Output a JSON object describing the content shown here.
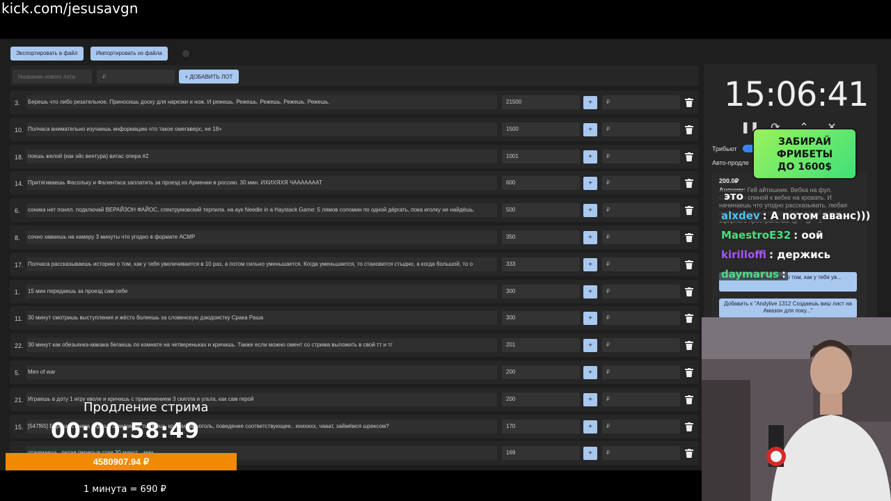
{
  "channel_url": "kick.com/jesusavgn",
  "toolbar": {
    "export_label": "Экспортировать в файл",
    "import_label": "Импортировать из файла"
  },
  "add_lot": {
    "name_placeholder": "Название нового лота",
    "amount_placeholder": "₽",
    "button_label": "+ ДОБАВИТЬ ЛОТ"
  },
  "lots": [
    {
      "num": "3.",
      "desc": "Берешь что либо резательное. Приносишь доску для нарезки и нож. И режешь. Режешь. Режешь. Режешь. Режешь.",
      "amount": "21500"
    },
    {
      "num": "10.",
      "desc": "Полчаса внимательно изучаешь информацию что такое омегаверс, не 18+",
      "amount": "1500"
    },
    {
      "num": "18.",
      "desc": "поешь желой (как эйс вентура) витас опера #2",
      "amount": "1001"
    },
    {
      "num": "14.",
      "desc": "Притягиваешь Фасольку и Фалентаса заплатить за проезд из Армении в россию. 30 мин. ИХИХЯХЯ ЧАААААААТ",
      "amount": "600"
    },
    {
      "num": "6.",
      "desc": "соника нет понял. подключай ВЕРАЙЗОН ФАЙОС, спектрумовский терпила. на аук Needle in a Haystack Game: 5 лямов соломин по одной дёргать, пока иголку не найдёшь.",
      "amount": "500"
    },
    {
      "num": "8.",
      "desc": "сочно хаваешь на камеру 3 минуты что угодно в формате АСМР",
      "amount": "350"
    },
    {
      "num": "17.",
      "desc": "Полчаса рассказываешь историю о том, как у тебя увеличивается в 10 раз, а потом сильно уменьшается. Когда уменьшается, то становится стыдно, а когда большой, то о",
      "amount": "333"
    },
    {
      "num": "1.",
      "desc": "15 мин передаешь за проезд сам себе",
      "amount": "300"
    },
    {
      "num": "11.",
      "desc": "30 минут смотришь выступления и жёсто болеешь за словенскую дзюдоистку Срака Раша",
      "amount": "300"
    },
    {
      "num": "22.",
      "desc": "30 минут как обезьянка-макака бегаешь по комнате на четвереньках и кричишь. Также если можно омент со стрима выложить в свой тт и тг",
      "amount": "201"
    },
    {
      "num": "5.",
      "desc": "Men of war",
      "amount": "200"
    },
    {
      "num": "21.",
      "desc": "Играешь в доту 1 игру кволе и кричишь с применением 3 скилла и ульта, как сам герой",
      "amount": "200"
    },
    {
      "num": "15.",
      "desc": "[547f65] Берешь стрима сидишь с видом ну ты пьешь крепкий алкоголь, поведение соответствующее.. ихихихх, чааат, займёмся шрексом?",
      "amount": "170"
    },
    {
      "num": "",
      "desc": "отжимаешь, делая перерыв стая 30 минут... мин",
      "amount": "169"
    }
  ],
  "rub_placeholder": "₽",
  "plus_label": "+",
  "timer": {
    "clock": "15:06:41",
    "tributes_label": "Трибьют",
    "autoextend_label": "Авто-продле"
  },
  "promo": {
    "line1": "ЗАБИРАЙ",
    "line2": "ФРИБЕТЫ",
    "line3": "ДО 1600$"
  },
  "donation": {
    "amount": "200.0₽",
    "author": "Аноним:",
    "text": "Гей айтишник. Вебка на фул. Садишся спиной к вебке на кровать. И начинаешь что угодно рассказывать. любая история, словно говори без сделай вокруг эфирного пространства. @ ~ @ ~ z",
    "suggest1": "...вадаешь историю о том, как у тебя ув...",
    "suggest2": "Добавить к \"Andylive 1312 Создаешь виш лист на Амазон для поку...\""
  },
  "chat": [
    {
      "user": "",
      "msg": "это",
      "color": "#ffffff"
    },
    {
      "user": "alxdev",
      "msg": ": А потом аванс)))",
      "color": "#4fc3f7"
    },
    {
      "user": "MaestroE32",
      "msg": ": оой",
      "color": "#4ade80"
    },
    {
      "user": "kirilloffi",
      "msg": ": держись",
      "color": "#a855f7"
    },
    {
      "user": "daymarus",
      "msg": ":",
      "color": "#4ade80"
    }
  ],
  "extension": {
    "title": "Продление стрима",
    "timer": "00:00:58:49",
    "sum": "4580907.94 ₽",
    "rate": "1 минута = 690 ₽"
  },
  "colors": {
    "accent_button": "#a9c8ef",
    "extension_bar": "#f08a00",
    "toggle": "#3b82f6"
  }
}
